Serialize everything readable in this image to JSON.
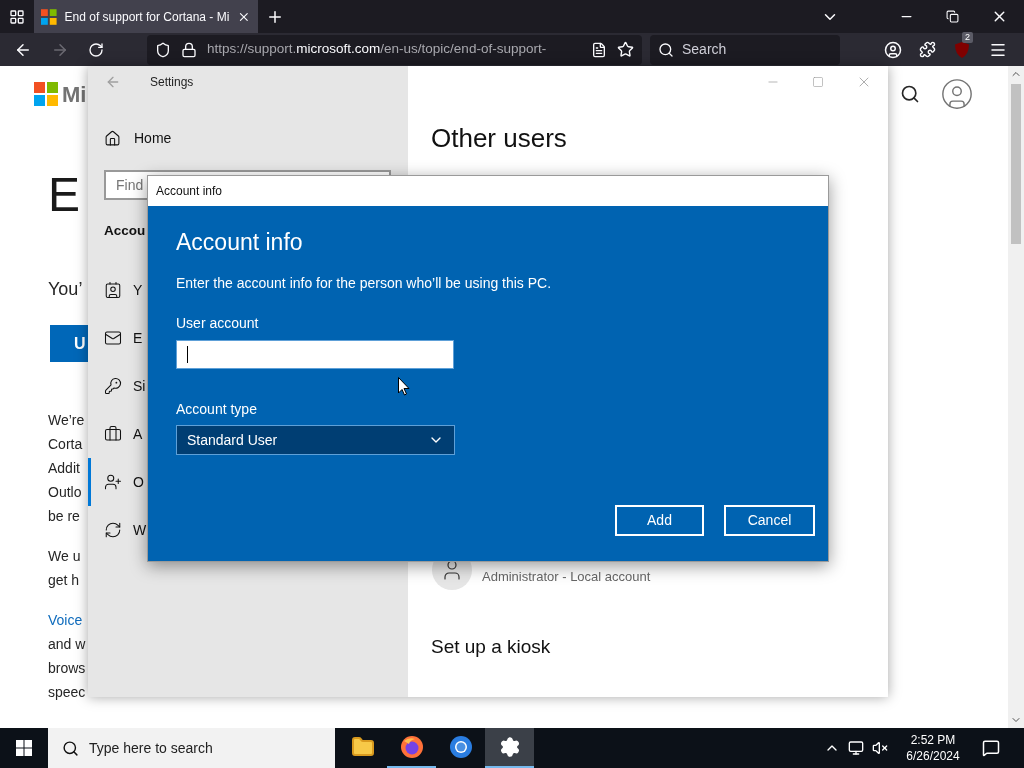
{
  "browser": {
    "tabs": [
      {
        "title": "End of support for Cortana - Mi",
        "selected": true
      }
    ],
    "forward_enabled": false,
    "address": {
      "prefix": "https://support.",
      "domain": "microsoft.com",
      "path": "/en-us/topic/end-of-support-"
    },
    "search": {
      "placeholder": "Search"
    },
    "extension_badge": "2"
  },
  "webpage": {
    "brand": "Mi",
    "heading": "E",
    "subtitle": "You’",
    "button": "U",
    "paragraphs": [
      [
        {
          "text": "We’re",
          "kind": "text"
        },
        {
          "text": "Corta",
          "kind": "text"
        },
        {
          "text": "Addit",
          "kind": "text"
        },
        {
          "text": "Outlo",
          "kind": "text"
        },
        {
          "text": "be re",
          "kind": "text"
        }
      ],
      [
        {
          "text": "We u",
          "kind": "text"
        },
        {
          "text": "get h",
          "kind": "text"
        }
      ],
      [
        {
          "text": "Voice",
          "kind": "link"
        },
        {
          "text": "and w",
          "kind": "text"
        },
        {
          "text": "brows",
          "kind": "text"
        },
        {
          "text": "speec",
          "kind": "text"
        }
      ]
    ]
  },
  "settings": {
    "title": "Settings",
    "home": "Home",
    "search_placeholder": "Find",
    "section": "Accou",
    "nav": [
      {
        "label": "Y",
        "kind": "contact",
        "selected": false
      },
      {
        "label": "E",
        "kind": "mail",
        "selected": false
      },
      {
        "label": "Si",
        "kind": "key",
        "selected": false
      },
      {
        "label": "A",
        "kind": "briefcase",
        "selected": false
      },
      {
        "label": "O",
        "kind": "person-add",
        "selected": true
      },
      {
        "label": "W",
        "kind": "sync",
        "selected": false
      }
    ],
    "page_title": "Other users",
    "account_detail": "Administrator - Local account",
    "kiosk_heading": "Set up a kiosk"
  },
  "dialog": {
    "title": "Account info",
    "heading": "Account info",
    "description": "Enter the account info for the person who’ll be using this PC.",
    "user_label": "User account",
    "type_label": "Account type",
    "type_value": "Standard User",
    "buttons": [
      "Add",
      "Cancel"
    ]
  },
  "taskbar": {
    "search_placeholder": "Type here to search",
    "apps": [
      {
        "kind": "files",
        "open": false,
        "selected": false
      },
      {
        "kind": "firefox",
        "open": true,
        "selected": false
      },
      {
        "kind": "chrome",
        "open": false,
        "selected": false
      },
      {
        "kind": "settings",
        "open": true,
        "selected": true
      }
    ],
    "volume_muted": true,
    "time": "2:52 PM",
    "date": "6/26/2024"
  }
}
